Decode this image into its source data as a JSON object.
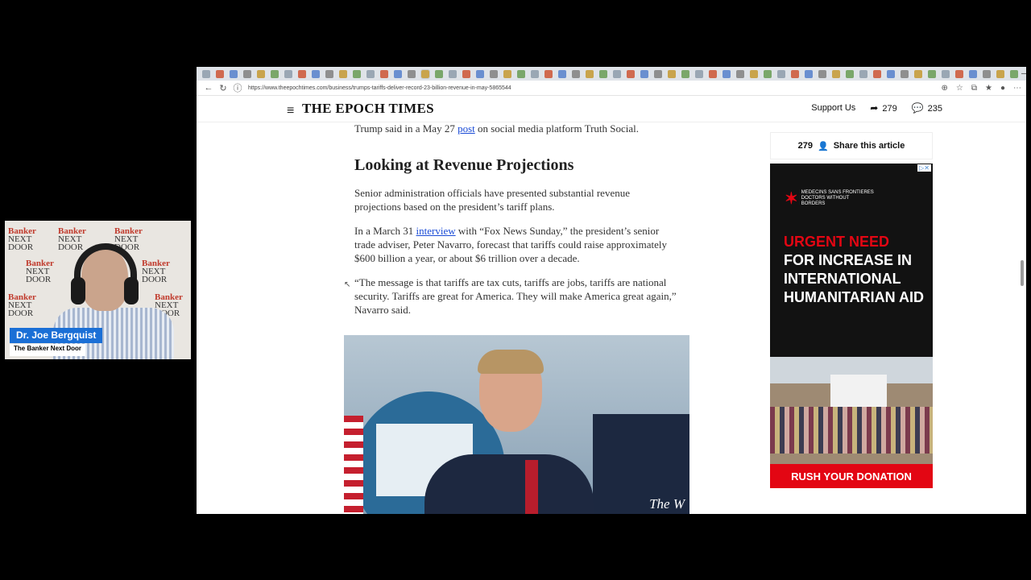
{
  "webcam": {
    "name": "Dr. Joe Bergquist",
    "show": "The Banker Next Door",
    "backdrop_logo_line1": "Banker",
    "backdrop_logo_line2": "NEXT DOOR"
  },
  "browser": {
    "url": "https://www.theepochtimes.com/business/trumps-tariffs-deliver-record-23-billion-revenue-in-may-5865544",
    "tab_count_icons": 60
  },
  "site": {
    "masthead": "THE EPOCH TIMES",
    "support": "Support Us",
    "shares": "279",
    "comments": "235"
  },
  "article": {
    "intro_pre": "Trump said in a May 27 ",
    "intro_link": "post",
    "intro_post": " on social media platform Truth Social.",
    "heading": "Looking at Revenue Projections",
    "p1": "Senior administration officials have presented substantial revenue projections based on the president’s tariff plans.",
    "p2_pre": "In a March 31 ",
    "p2_link": "interview",
    "p2_post": " with “Fox News Sunday,” the president’s senior trade adviser, Peter Navarro, forecast that tariffs could raise approximately $600 billion a year, or about $6 trillion over a decade.",
    "p3": "“The message is that tariffs are tax cuts, tariffs are jobs, tariffs are national security. Tariffs are great for America. They will make America great again,” Navarro said.",
    "photo_watermark": "The W"
  },
  "sidebar": {
    "share_count": "279",
    "share_label": "Share this article"
  },
  "ad": {
    "org_line1": "MEDECINS SANS FRONTIERES",
    "org_line2": "DOCTORS WITHOUT BORDERS",
    "headline_red": "URGENT NEED",
    "headline_rest": "FOR INCREASE IN INTERNATIONAL HUMANITARIAN AID",
    "cta": "RUSH YOUR DONATION"
  }
}
